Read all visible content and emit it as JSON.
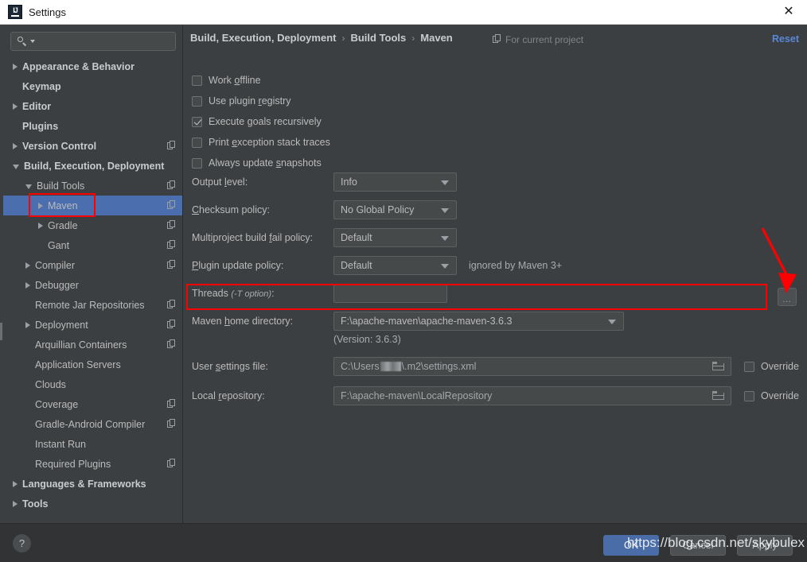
{
  "window": {
    "title": "Settings",
    "app_icon": "intellij-idea-icon",
    "close_icon": "close-icon"
  },
  "sidebar": {
    "search": {
      "placeholder": "",
      "value": "",
      "icon": "search-icon"
    },
    "items": [
      {
        "label": "Appearance & Behavior",
        "indent": 0,
        "arrow": "closed",
        "bold": true,
        "copy": false,
        "selected": false
      },
      {
        "label": "Keymap",
        "indent": 0,
        "arrow": "none",
        "bold": true,
        "copy": false,
        "selected": false
      },
      {
        "label": "Editor",
        "indent": 0,
        "arrow": "closed",
        "bold": true,
        "copy": false,
        "selected": false
      },
      {
        "label": "Plugins",
        "indent": 0,
        "arrow": "none",
        "bold": true,
        "copy": false,
        "selected": false
      },
      {
        "label": "Version Control",
        "indent": 0,
        "arrow": "closed",
        "bold": true,
        "copy": true,
        "selected": false
      },
      {
        "label": "Build, Execution, Deployment",
        "indent": 0,
        "arrow": "open",
        "bold": true,
        "copy": false,
        "selected": false
      },
      {
        "label": "Build Tools",
        "indent": 1,
        "arrow": "open",
        "bold": false,
        "copy": true,
        "selected": false
      },
      {
        "label": "Maven",
        "indent": 2,
        "arrow": "closed",
        "bold": false,
        "copy": true,
        "selected": true
      },
      {
        "label": "Gradle",
        "indent": 2,
        "arrow": "closed",
        "bold": false,
        "copy": true,
        "selected": false
      },
      {
        "label": "Gant",
        "indent": 2,
        "arrow": "none",
        "bold": false,
        "copy": true,
        "selected": false
      },
      {
        "label": "Compiler",
        "indent": 1,
        "arrow": "closed",
        "bold": false,
        "copy": true,
        "selected": false
      },
      {
        "label": "Debugger",
        "indent": 1,
        "arrow": "closed",
        "bold": false,
        "copy": false,
        "selected": false
      },
      {
        "label": "Remote Jar Repositories",
        "indent": 1,
        "arrow": "none",
        "bold": false,
        "copy": true,
        "selected": false
      },
      {
        "label": "Deployment",
        "indent": 1,
        "arrow": "closed",
        "bold": false,
        "copy": true,
        "selected": false
      },
      {
        "label": "Arquillian Containers",
        "indent": 1,
        "arrow": "none",
        "bold": false,
        "copy": true,
        "selected": false
      },
      {
        "label": "Application Servers",
        "indent": 1,
        "arrow": "none",
        "bold": false,
        "copy": false,
        "selected": false
      },
      {
        "label": "Clouds",
        "indent": 1,
        "arrow": "none",
        "bold": false,
        "copy": false,
        "selected": false
      },
      {
        "label": "Coverage",
        "indent": 1,
        "arrow": "none",
        "bold": false,
        "copy": true,
        "selected": false
      },
      {
        "label": "Gradle-Android Compiler",
        "indent": 1,
        "arrow": "none",
        "bold": false,
        "copy": true,
        "selected": false
      },
      {
        "label": "Instant Run",
        "indent": 1,
        "arrow": "none",
        "bold": false,
        "copy": false,
        "selected": false
      },
      {
        "label": "Required Plugins",
        "indent": 1,
        "arrow": "none",
        "bold": false,
        "copy": true,
        "selected": false
      },
      {
        "label": "Languages & Frameworks",
        "indent": 0,
        "arrow": "closed",
        "bold": true,
        "copy": false,
        "selected": false
      },
      {
        "label": "Tools",
        "indent": 0,
        "arrow": "closed",
        "bold": true,
        "copy": false,
        "selected": false
      }
    ]
  },
  "main": {
    "breadcrumb": [
      "Build, Execution, Deployment",
      "Build Tools",
      "Maven"
    ],
    "breadcrumb_separator": "›",
    "for_current_project": "For current project",
    "for_current_project_icon": "copy-icon",
    "reset_label": "Reset",
    "checkboxes": [
      {
        "label": "Work offline",
        "checked": false
      },
      {
        "label": "Use plugin registry",
        "checked": false
      },
      {
        "label": "Execute goals recursively",
        "checked": true
      },
      {
        "label": "Print exception stack traces",
        "checked": false
      },
      {
        "label": "Always update snapshots",
        "checked": false
      }
    ],
    "fields": {
      "output_level": {
        "label": "Output level:",
        "value": "Info"
      },
      "checksum_policy": {
        "label": "Checksum policy:",
        "value": "No Global Policy"
      },
      "multiproject": {
        "label": "Multiproject build fail policy:",
        "value": "Default"
      },
      "plugin_update": {
        "label": "Plugin update policy:",
        "value": "Default",
        "note": "ignored by Maven 3+"
      },
      "threads": {
        "label": "Threads",
        "label_suffix": "(-T option)",
        "label_tail": ":",
        "value": ""
      },
      "maven_home": {
        "label": "Maven home directory:",
        "value": "F:\\apache-maven\\apache-maven-3.6.3"
      },
      "version_note": "(Version: 3.6.3)",
      "user_settings": {
        "label": "User settings file:",
        "value_pre": "C:\\Users",
        "value_post": "\\.m2\\settings.xml",
        "override_label": "Override",
        "override_checked": false,
        "browse_icon": "folder-icon"
      },
      "local_repository": {
        "label": "Local repository:",
        "value": "F:\\apache-maven\\LocalRepository",
        "override_label": "Override",
        "override_checked": false,
        "browse_icon": "folder-icon"
      }
    },
    "browse_button_label": "…"
  },
  "footer": {
    "help_label": "?",
    "ok_label": "OK",
    "cancel_label": "Cancel",
    "apply_label": "Apply"
  },
  "watermark": {
    "text": "https://blog.csdn.net/skybulex"
  },
  "colors": {
    "background": "#3c3f41",
    "selection": "#4b6eaf",
    "accent_link": "#5a87d6",
    "annotation_red": "#ff0000",
    "primary_button": "#4a6da7",
    "text": "#bbbbbb"
  }
}
